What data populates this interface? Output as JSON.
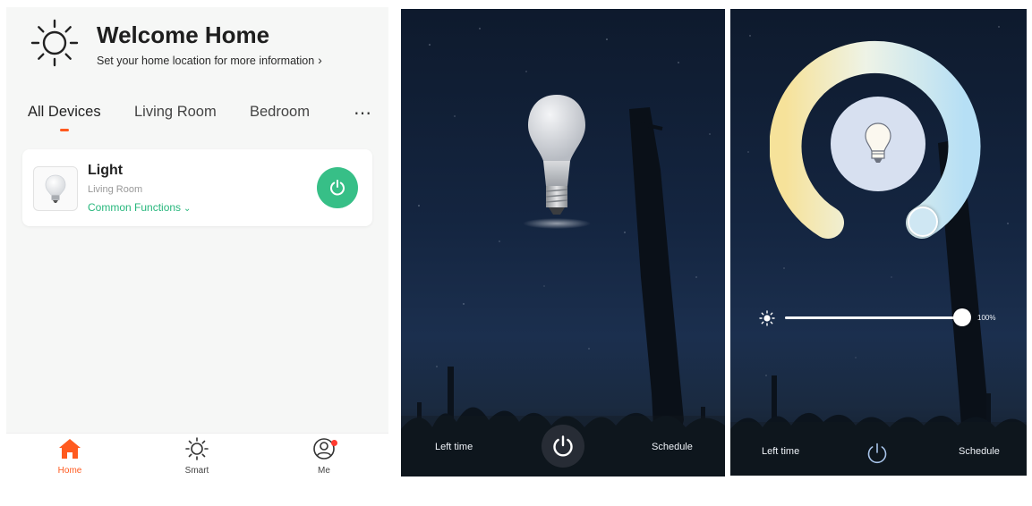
{
  "home": {
    "title": "Welcome Home",
    "subtitle": "Set your home location for more information",
    "subtitle_chevron": "›",
    "tabs": [
      {
        "label": "All Devices",
        "active": true
      },
      {
        "label": "Living Room",
        "active": false
      },
      {
        "label": "Bedroom",
        "active": false
      }
    ],
    "more_icon": "⋯",
    "device": {
      "name": "Light",
      "room": "Living Room",
      "functions_label": "Common Functions",
      "functions_chevron": "⌄",
      "power_on": true
    },
    "nav": [
      {
        "label": "Home",
        "icon": "home-icon",
        "active": true
      },
      {
        "label": "Smart",
        "icon": "sun-icon",
        "active": false
      },
      {
        "label": "Me",
        "icon": "user-icon",
        "active": false,
        "badge": true
      }
    ]
  },
  "bulb_screen": {
    "left_label": "Left time",
    "right_label": "Schedule"
  },
  "control_screen": {
    "brightness_percent": 100,
    "brightness_label": "100%",
    "left_label": "Left time",
    "right_label": "Schedule"
  },
  "colors": {
    "accent_orange": "#ff5a1f",
    "accent_green": "#37bf87",
    "function_green": "#28b77d",
    "warm_white": "#f7e7a6",
    "cool_white": "#bfe3f6"
  }
}
